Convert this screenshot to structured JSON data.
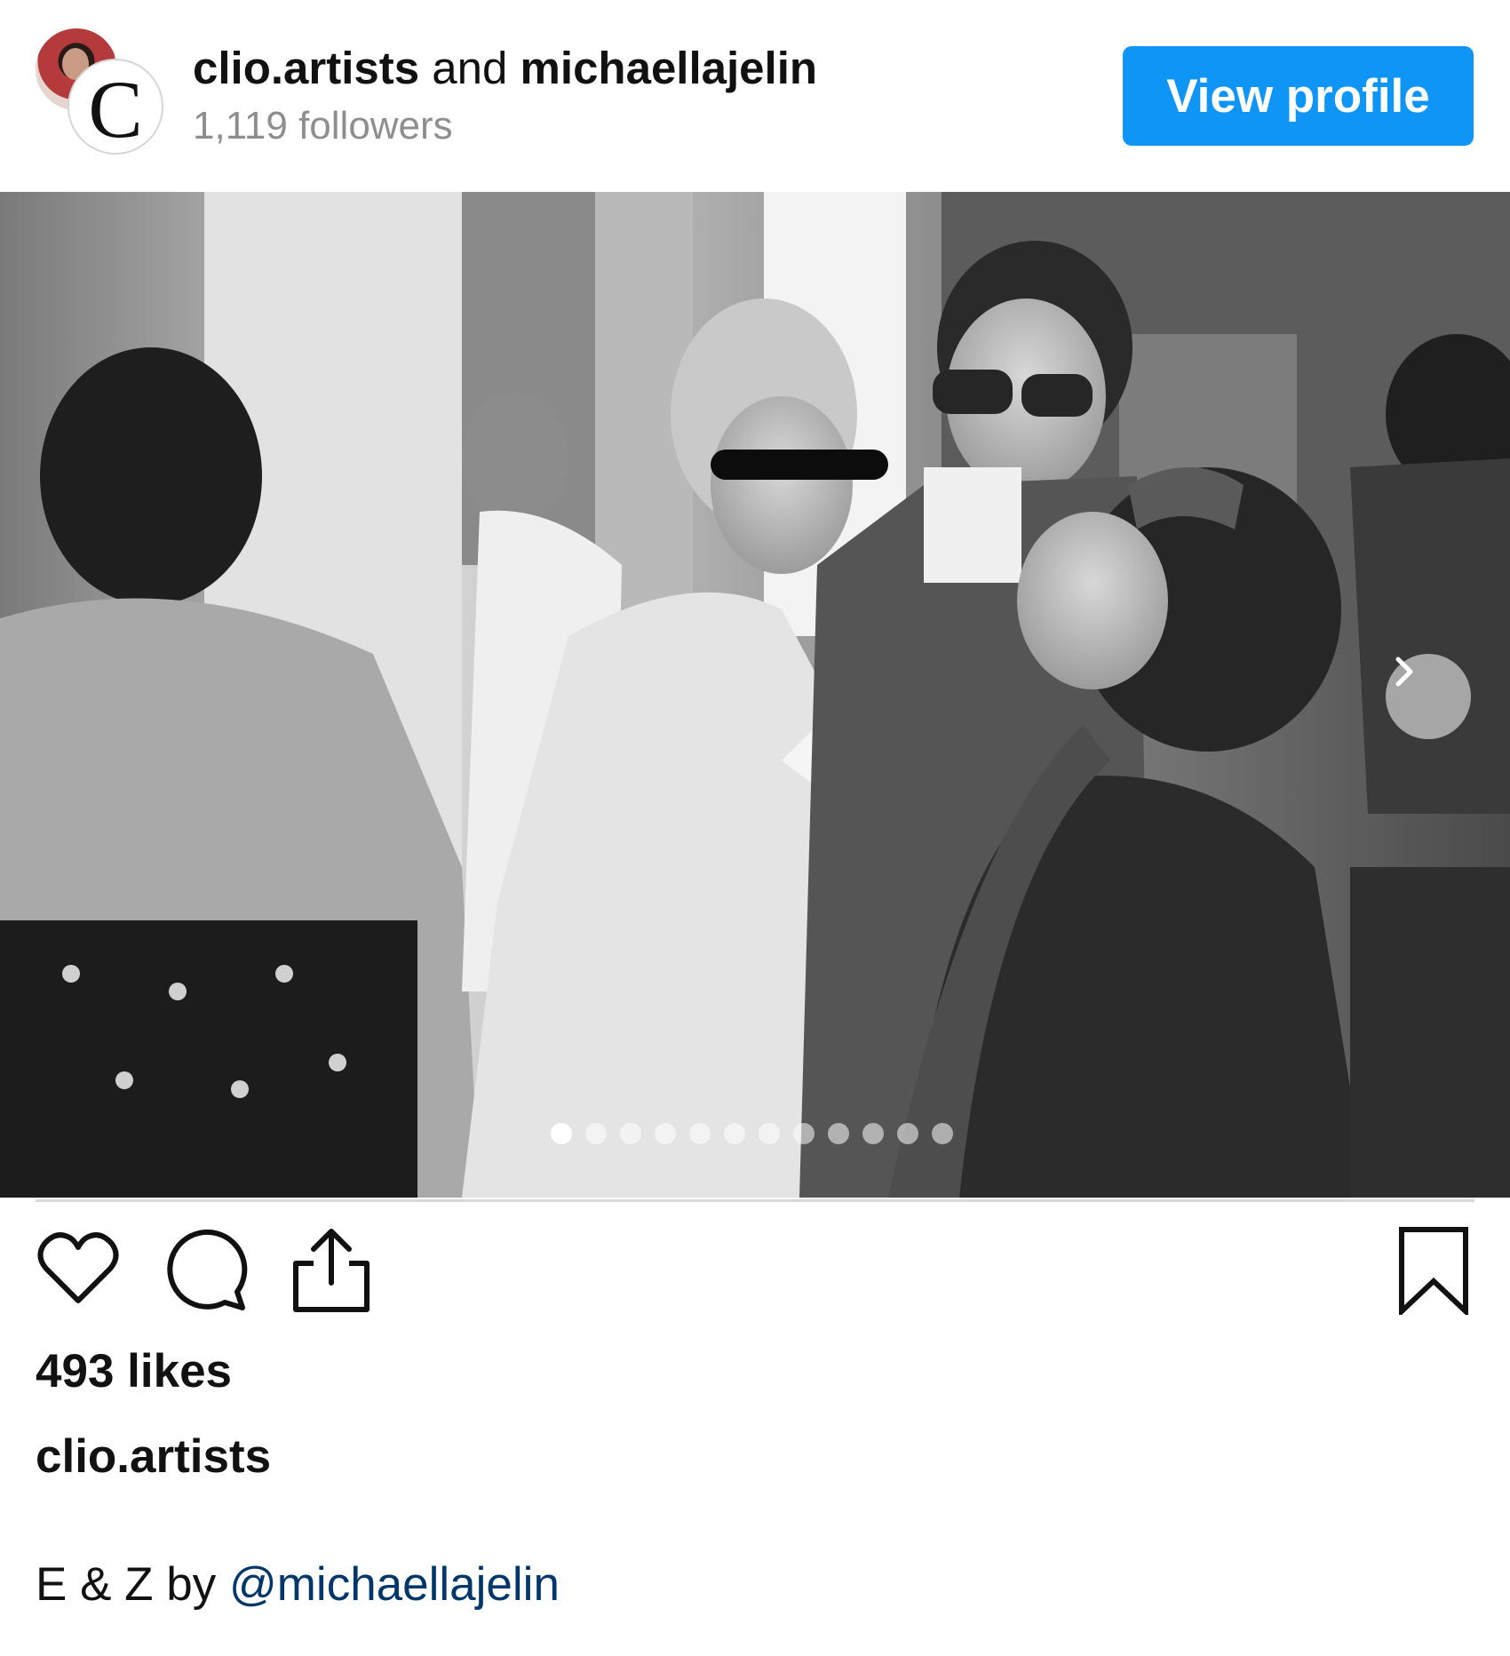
{
  "header": {
    "account_primary": "clio.artists",
    "and_text": "and",
    "account_secondary": "michaellajelin",
    "followers": "1,119 followers",
    "view_profile_label": "View profile",
    "avatar_letter": "C"
  },
  "carousel": {
    "total_slides": 12,
    "active_index": 0
  },
  "actions": {
    "like_icon": "heart-icon",
    "comment_icon": "comment-icon",
    "share_icon": "share-icon",
    "save_icon": "bookmark-icon"
  },
  "post": {
    "likes": "493 likes",
    "caption_user": "clio.artists",
    "caption_text": "E & Z by",
    "caption_mention": "@michaellajelin"
  },
  "colors": {
    "accent": "#0f95f6",
    "mention": "#00376b",
    "muted": "#8e8e8e"
  }
}
